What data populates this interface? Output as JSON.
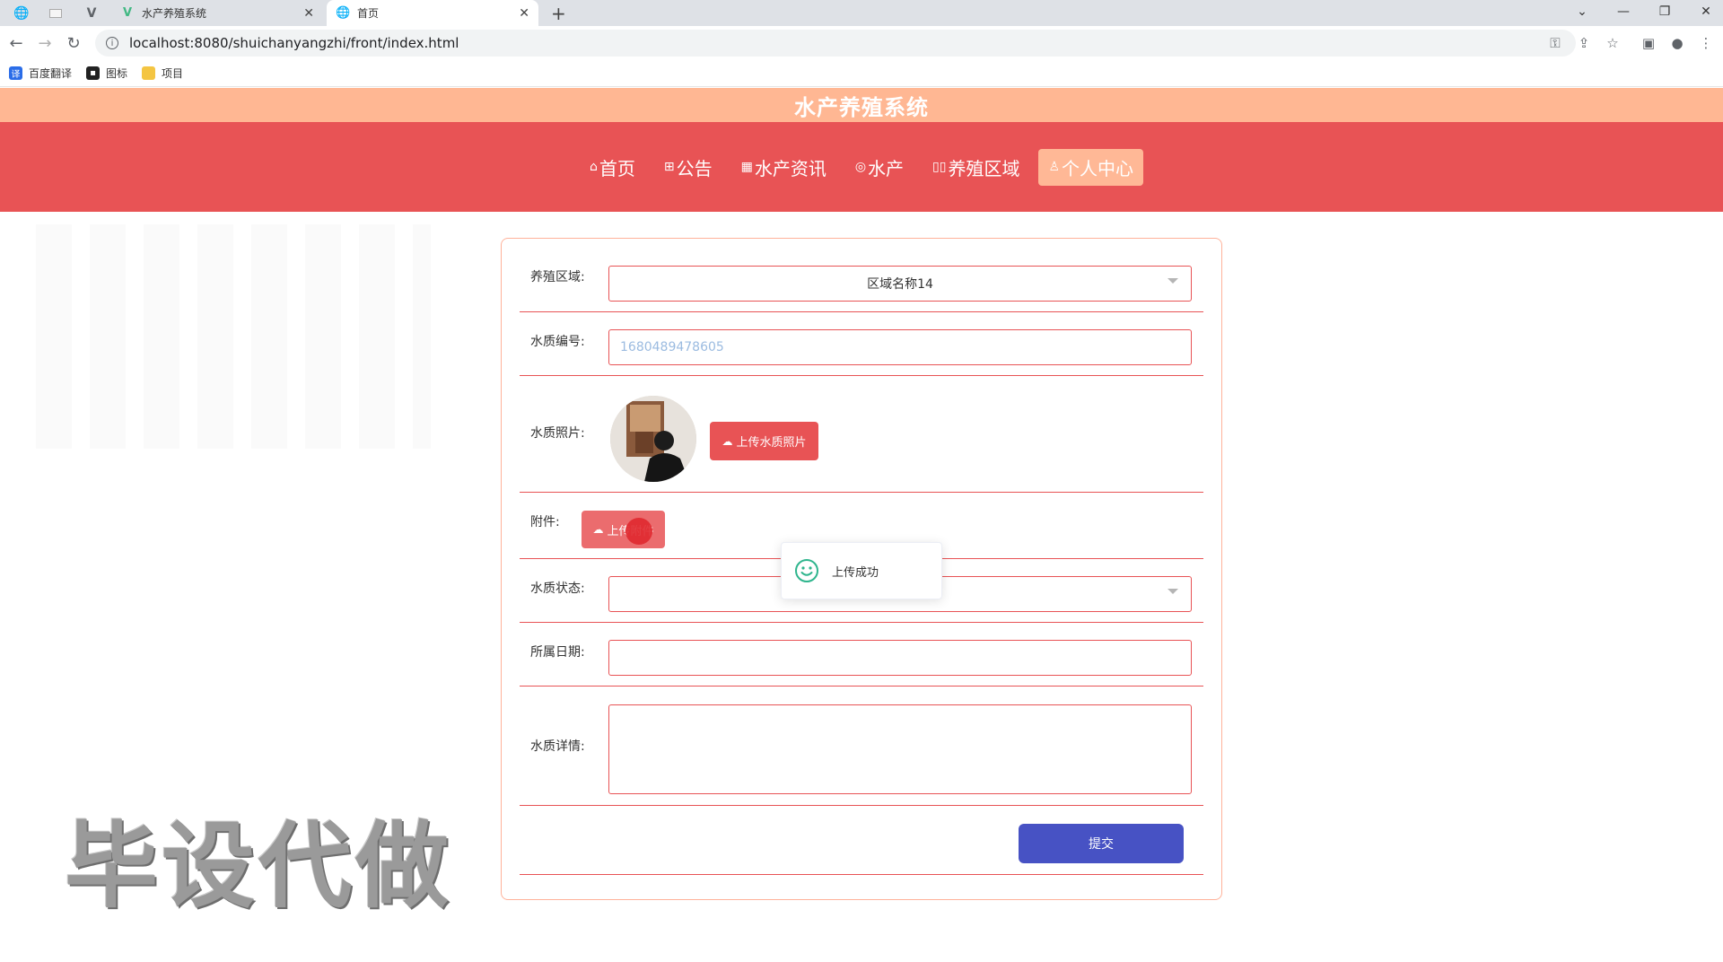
{
  "browser": {
    "tabs": [
      {
        "label": "水产养殖系统",
        "icon": "vue-icon"
      },
      {
        "label": "首页",
        "icon": "globe-icon",
        "active": true
      }
    ],
    "url": "localhost:8080/shuichanyangzhi/front/index.html",
    "bookmarks": [
      {
        "label": "百度翻译",
        "icon": "translate-icon",
        "color": "#2b6de8"
      },
      {
        "label": "图标",
        "icon": "image-icon",
        "color": "#222222"
      },
      {
        "label": "项目",
        "icon": "folder-icon",
        "color": "#f4c542"
      }
    ]
  },
  "site": {
    "title": "水产养殖系统",
    "nav": [
      {
        "label": "首页",
        "icon": "home-icon"
      },
      {
        "label": "公告",
        "icon": "gift-icon"
      },
      {
        "label": "水产资讯",
        "icon": "grid-icon"
      },
      {
        "label": "水产",
        "icon": "fish-icon"
      },
      {
        "label": "养殖区域",
        "icon": "columns-icon"
      },
      {
        "label": "个人中心",
        "icon": "user-icon",
        "active": true
      }
    ],
    "accent": "#e85355",
    "header_color": "#ffb793"
  },
  "form": {
    "region_label": "养殖区域:",
    "region_value": "区域名称14",
    "code_label": "水质编号:",
    "code_value": "1680489478605",
    "photo_label": "水质照片:",
    "photo_upload_label": "上传水质照片",
    "attachment_label": "附件:",
    "attachment_upload_label": "上传附件",
    "status_label": "水质状态:",
    "status_value": "",
    "date_label": "所属日期:",
    "date_value": "",
    "detail_label": "水质详情:",
    "detail_value": "",
    "submit_label": "提交",
    "submit_color": "#4752c4"
  },
  "toast": {
    "message": "上传成功"
  },
  "watermark": "毕设代做"
}
